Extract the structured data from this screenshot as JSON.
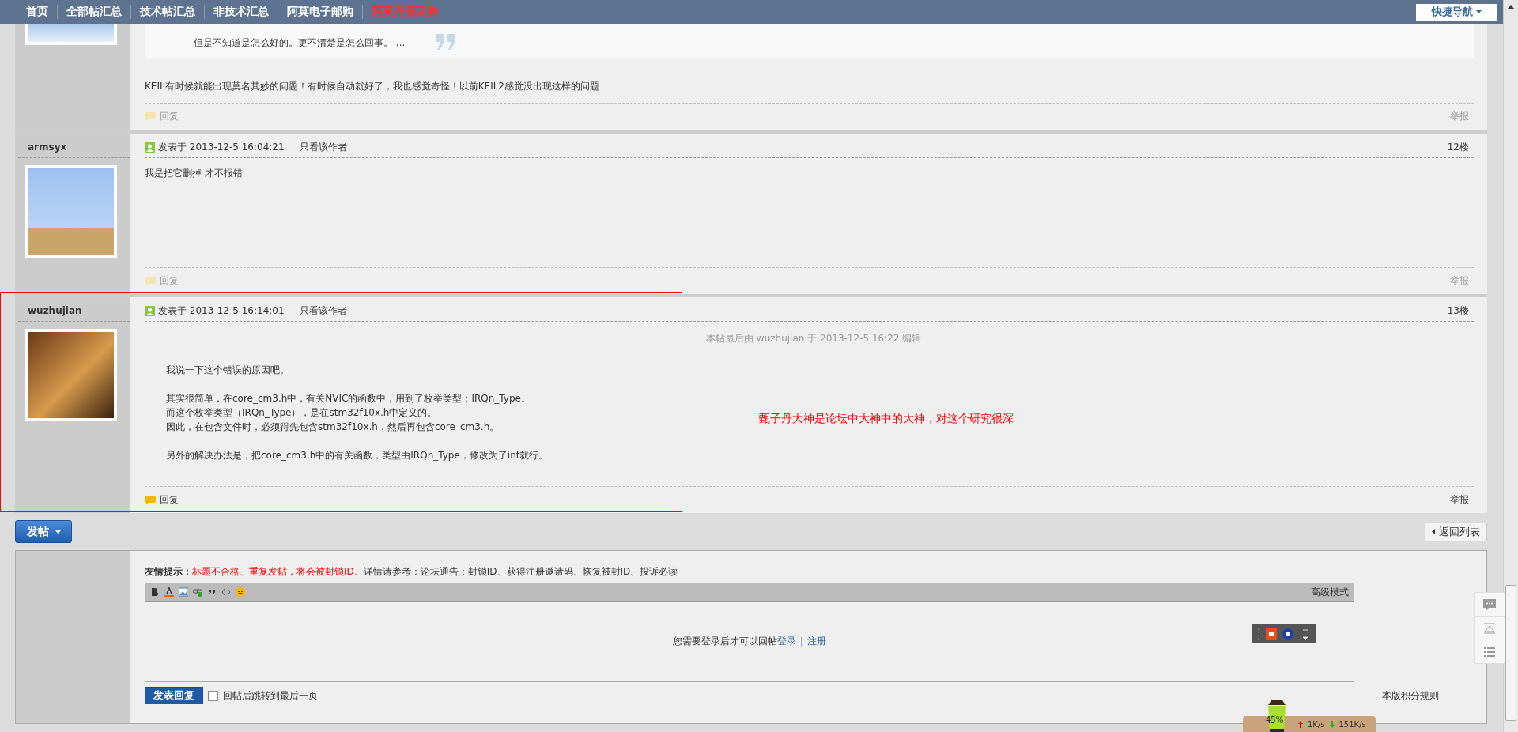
{
  "nav": {
    "items": [
      {
        "label": "首页",
        "highlight": false
      },
      {
        "label": "全部帖汇总",
        "highlight": false
      },
      {
        "label": "技术帖汇总",
        "highlight": false
      },
      {
        "label": "非技术汇总",
        "highlight": false
      },
      {
        "label": "阿莫电子邮购",
        "highlight": false
      },
      {
        "label": "阿莫洋酒团购",
        "highlight": true
      }
    ],
    "quick_nav": "快捷导航"
  },
  "posts": [
    {
      "kind": "continued",
      "quote": "但是不知道是怎么好的。更不清楚是怎么回事。 ...",
      "body": [
        [
          "KEIL有时候就能出现莫名其妙的问题！有时候自动就好了，我也感觉奇怪！以前KEIL2感觉没出现这样的问题"
        ]
      ],
      "reply": "回复",
      "report": "举报",
      "actions_active": false
    },
    {
      "kind": "full",
      "author": "armsyx",
      "posted_label": "发表于",
      "time": "2013-12-5 16:04:21",
      "author_only": "只看该作者",
      "floor": "12楼",
      "body": [
        [
          "我是把它删掉 才不报错"
        ]
      ],
      "reply": "回复",
      "report": "举报",
      "actions_active": false
    },
    {
      "kind": "full",
      "author": "wuzhujian",
      "posted_label": "发表于",
      "time": "2013-12-5 16:14:01",
      "author_only": "只看该作者",
      "floor": "13楼",
      "edit_note": "本帖最后由 wuzhujian 于 2013-12-5 16:22 编辑",
      "body": [
        [
          "我说一下这个错误的原因吧。"
        ],
        [
          "其实很简单，在core_cm3.h中，有关NVIC的函数中，用到了枚举类型：IRQn_Type。",
          "而这个枚举类型（IRQn_Type），是在stm32f10x.h中定义的。",
          "因此，在包含文件时，必须得先包含stm32f10x.h，然后再包含core_cm3.h。"
        ],
        [
          "另外的解决办法是，把core_cm3.h中的有关函数，类型由IRQn_Type，修改为了int就行。"
        ]
      ],
      "reply": "回复",
      "report": "举报",
      "actions_active": true
    }
  ],
  "annotation": {
    "text": "甄子丹大神是论坛中大神中的大神，对这个研究很深"
  },
  "actions": {
    "new_post": "发帖",
    "back": "返回列表"
  },
  "reply_form": {
    "tips": {
      "label": "友情提示：",
      "warning": "标题不合格、重复发帖，将会被封锁ID。",
      "details": "详情请参考：论坛通告：封锁ID、获得注册邀请码、恢复被封ID、投诉必读"
    },
    "editor": {
      "mode": "高级模式",
      "login_prompt": "您需要登录后才可以回帖",
      "login": "登录",
      "separator": "|",
      "register": "注册"
    },
    "submit": "发表回复",
    "jump_label": "回帖后跳转到最后一页",
    "jump_checked": false,
    "rules": "本版积分规则"
  },
  "net_widget": {
    "battery": "45%",
    "up": "1K/s",
    "down": "151K/s"
  }
}
